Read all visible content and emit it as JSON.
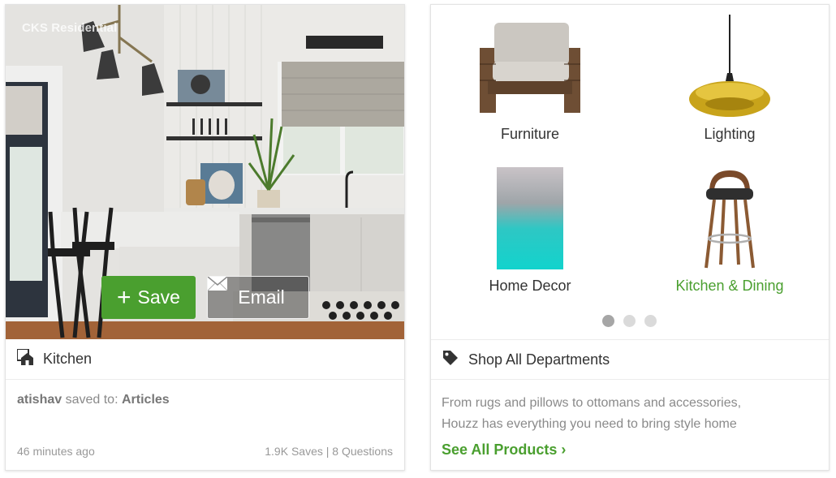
{
  "left_card": {
    "watermark": "CKS Residential",
    "save_label": "Save",
    "email_label": "Email",
    "category_title": "Kitchen",
    "saved_user": "atishav",
    "saved_text": "saved to:",
    "saved_board": "Articles",
    "time_ago": "46 minutes ago",
    "saves": "1.9K Saves",
    "separator": "|",
    "questions": "8 Questions"
  },
  "right_card": {
    "categories": [
      {
        "label": "Furniture",
        "active": false
      },
      {
        "label": "Lighting",
        "active": false
      },
      {
        "label": "Home Decor",
        "active": false
      },
      {
        "label": "Kitchen & Dining",
        "active": true
      }
    ],
    "carousel": {
      "pages": 3,
      "current": 1
    },
    "shop_title": "Shop All Departments",
    "description_line1": "From rugs and pillows to ottomans and accessories,",
    "description_line2": "Houzz has everything you need to bring style home",
    "see_all_label": "See All Products",
    "see_all_chevron": "›"
  },
  "colors": {
    "accent_green": "#4a9f2f",
    "text_dark": "#333333",
    "text_muted": "#8a8a8a"
  }
}
